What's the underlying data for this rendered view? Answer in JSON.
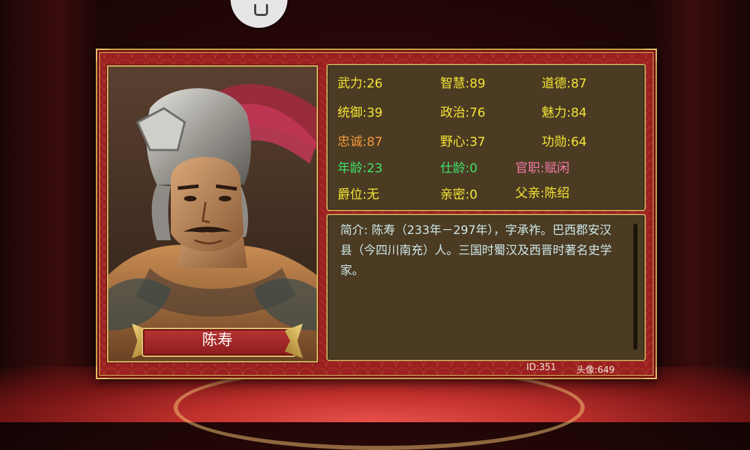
{
  "colors": {
    "yellow": "#f2e534",
    "orange": "#f29a3a",
    "green": "#3ee06a",
    "pink": "#f27aa8",
    "bio_text": "#cde8ea",
    "panel_red": "#9b2020",
    "gold_border": "#d8b45e"
  },
  "general": {
    "name": "陈寿",
    "id_text": "ID:351",
    "avatar_text": "头像:649"
  },
  "stats": [
    {
      "key": "wuli",
      "text": "武力:26",
      "color": "yellow"
    },
    {
      "key": "zhihui",
      "text": "智慧:89",
      "color": "yellow"
    },
    {
      "key": "daode",
      "text": "道德:87",
      "color": "yellow"
    },
    {
      "key": "tongyu",
      "text": "统御:39",
      "color": "yellow"
    },
    {
      "key": "zhengzhi",
      "text": "政治:76",
      "color": "yellow"
    },
    {
      "key": "meili",
      "text": "魅力:84",
      "color": "yellow"
    },
    {
      "key": "zhongcheng",
      "text": "忠诚:87",
      "color": "orange"
    },
    {
      "key": "yexin",
      "text": "野心:37",
      "color": "yellow"
    },
    {
      "key": "gongxun",
      "text": "功勋:64",
      "color": "yellow"
    },
    {
      "key": "nianling",
      "text": "年龄:23",
      "color": "green"
    },
    {
      "key": "shiling",
      "text": "仕龄:0",
      "color": "green"
    },
    {
      "key": "guanzhi",
      "text": "官职:赋闲",
      "color": "pink"
    },
    {
      "key": "juewei",
      "text": "爵位:无",
      "color": "yellow"
    },
    {
      "key": "qinmi",
      "text": "亲密:0",
      "color": "yellow"
    },
    {
      "key": "fuqin",
      "text": "父亲:陈绍",
      "color": "yellow"
    }
  ],
  "bio": {
    "text": "简介: 陈寿（233年－297年），字承祚。巴西郡安汉县（今四川南充）人。三国时蜀汉及西晋时著名史学家。"
  },
  "icons": {
    "top_button": "home-icon",
    "portrait": "general-portrait-image"
  }
}
